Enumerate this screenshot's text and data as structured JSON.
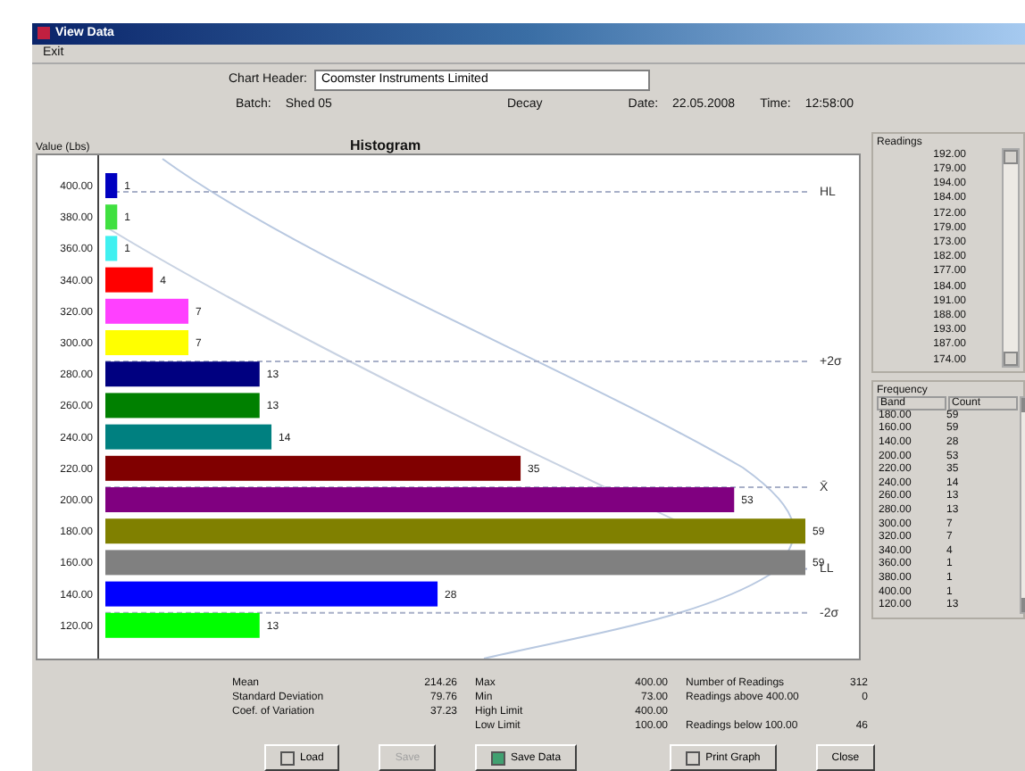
{
  "window": {
    "title": "View Data"
  },
  "menu": [
    "Exit"
  ],
  "header": {
    "chart_header_label": "Chart Header:",
    "chart_header_value": "Coomster Instruments Limited",
    "batch_label": "Batch:",
    "batch_value": "Shed 05",
    "decay": "Decay",
    "date_label": "Date:",
    "date_value": "22.05.2008",
    "time_label": "Time:",
    "time_value": "12:58:00"
  },
  "histogram": {
    "y_label": "Value (Lbs)",
    "chart_data": {
      "type": "bar",
      "orientation": "horizontal",
      "title": "Histogram",
      "categories": [
        "400.00",
        "380.00",
        "360.00",
        "340.00",
        "320.00",
        "300.00",
        "280.00",
        "260.00",
        "240.00",
        "220.00",
        "200.00",
        "180.00",
        "160.00",
        "140.00",
        "120.00"
      ],
      "series": [
        {
          "values": [
            1,
            1,
            1,
            4,
            7,
            7,
            13,
            13,
            14,
            35,
            53,
            59,
            59,
            28,
            13
          ]
        }
      ],
      "data_labels": true,
      "ref_lines": [
        {
          "label": "HL"
        },
        {
          "label": "+2σ"
        },
        {
          "label": "X̄"
        },
        {
          "label": "LL"
        },
        {
          "label": "-2σ"
        }
      ]
    }
  },
  "readings": {
    "title": "Readings",
    "items": [
      "192.00",
      "179.00",
      "194.00",
      "184.00",
      "172.00",
      "179.00",
      "173.00",
      "182.00",
      "177.00",
      "184.00",
      "191.00",
      "188.00",
      "193.00",
      "187.00",
      "174.00"
    ]
  },
  "frequency": {
    "title": "Frequency",
    "columns": [
      "Band",
      "Count"
    ],
    "rows": [
      [
        "180.00",
        "59"
      ],
      [
        "160.00",
        "59"
      ],
      [
        "140.00",
        "28"
      ],
      [
        "200.00",
        "53"
      ],
      [
        "220.00",
        "35"
      ],
      [
        "240.00",
        "14"
      ],
      [
        "260.00",
        "13"
      ],
      [
        "280.00",
        "13"
      ],
      [
        "300.00",
        "7"
      ],
      [
        "320.00",
        "7"
      ],
      [
        "340.00",
        "4"
      ],
      [
        "360.00",
        "1"
      ],
      [
        "380.00",
        "1"
      ],
      [
        "400.00",
        "1"
      ],
      [
        "120.00",
        "13"
      ]
    ]
  },
  "stats": [
    [
      {
        "label": "Mean",
        "value": "214.26"
      },
      {
        "label": "Standard Deviation",
        "value": "79.76"
      },
      {
        "label": "Coef. of Variation",
        "value": "37.23"
      }
    ],
    [
      {
        "label": "Max",
        "value": "400.00"
      },
      {
        "label": "Min",
        "value": "73.00"
      },
      {
        "label": "High Limit",
        "value": "400.00"
      },
      {
        "label": "Low Limit",
        "value": "100.00"
      }
    ],
    [
      {
        "label": "Number of Readings",
        "value": "312"
      },
      {
        "label": "Readings above 400.00",
        "value": "0"
      },
      {
        "label": "Readings below 100.00",
        "value": "46"
      }
    ]
  ],
  "buttons": [
    {
      "label": "Load",
      "disabled": false,
      "kind": "load"
    },
    {
      "label": "Save",
      "disabled": true,
      "kind": "save"
    },
    {
      "label": "Save Data",
      "disabled": false,
      "kind": "data"
    },
    {
      "label": "Print Graph",
      "disabled": false,
      "kind": "print"
    },
    {
      "label": "Close",
      "disabled": false,
      "kind": "close"
    }
  ]
}
